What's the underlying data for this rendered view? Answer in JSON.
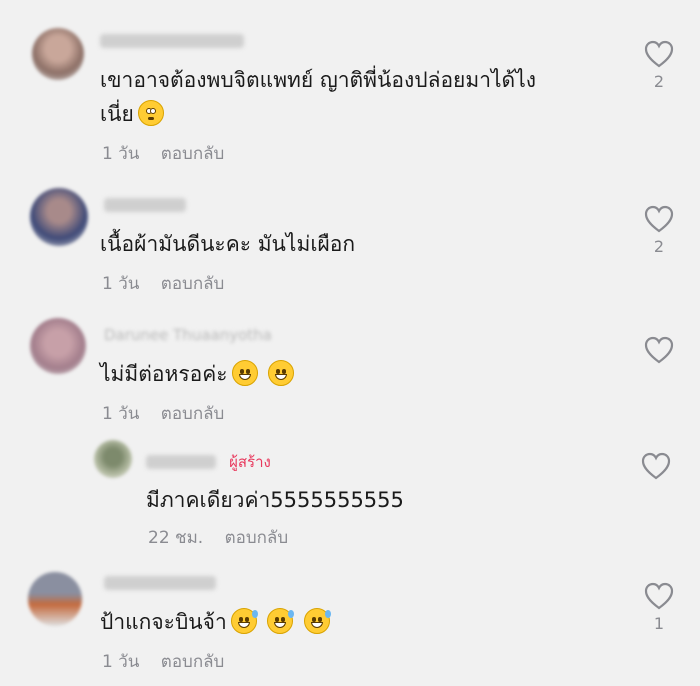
{
  "comments": [
    {
      "text": "เขาอาจต้องพบจิตแพทย์ ญาติพี่น้องปล่อยมาได้ไง",
      "text2": "เนี่ย",
      "emoji": "flushed-face-emoji",
      "time": "1 วัน",
      "reply": "ตอบกลับ",
      "likes": "2"
    },
    {
      "text": "เนื้อผ้ามันดีนะคะ  มันไม่เผือก",
      "time": "1 วัน",
      "reply": "ตอบกลับ",
      "likes": "2"
    },
    {
      "name": "Darunee Thuaanyotha",
      "text": "ไม่มีต่อหรอค่ะ",
      "emoji": "grinning-face-emoji",
      "time": "1 วัน",
      "reply": "ตอบกลับ",
      "likes": ""
    },
    {
      "creator_label": "ผู้สร้าง",
      "text": "มีภาคเดียวค่า5555555555",
      "time": "22 ชม.",
      "reply": "ตอบกลับ",
      "likes": ""
    },
    {
      "text": "ป้าแกจะบินจ้า",
      "emoji": "grinning-sweat-face-emoji",
      "time": "1 วัน",
      "reply": "ตอบกลับ",
      "likes": "1"
    }
  ]
}
